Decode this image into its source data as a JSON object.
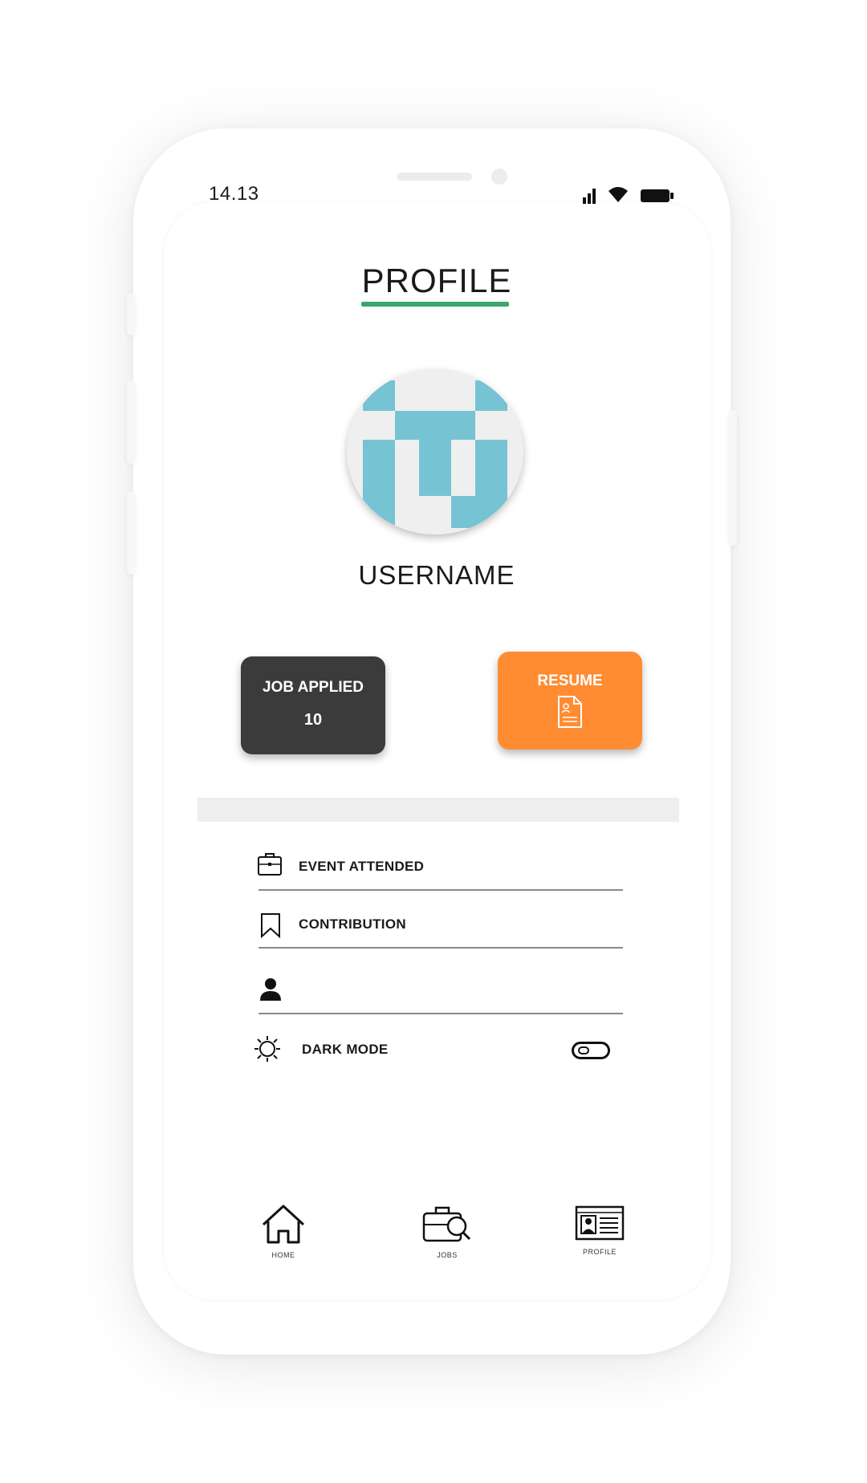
{
  "status_bar": {
    "time": "14.13"
  },
  "header": {
    "title": "PROFILE"
  },
  "profile": {
    "username": "USERNAME"
  },
  "stats": {
    "job_applied_label": "JOB APPLIED",
    "job_applied_count": "10",
    "resume_label": "RESUME"
  },
  "menu": {
    "items": [
      {
        "label": "EVENT ATTENDED",
        "icon": "briefcase-icon"
      },
      {
        "label": "CONTRIBUTION",
        "icon": "bookmark-icon"
      },
      {
        "label": "",
        "icon": "user-icon"
      },
      {
        "label": "DARK MODE",
        "icon": "sun-icon"
      }
    ],
    "dark_mode_enabled": false
  },
  "bottom_nav": {
    "items": [
      {
        "label": "HOME",
        "icon": "home-icon"
      },
      {
        "label": "JOBS",
        "icon": "job-search-icon"
      },
      {
        "label": "PROFILE",
        "icon": "id-card-icon"
      }
    ]
  },
  "colors": {
    "accent_green": "#3aa66b",
    "resume_orange": "#ff8c33",
    "jobs_card_dark": "#3b3b3b",
    "avatar_blue": "#76c3d3"
  }
}
